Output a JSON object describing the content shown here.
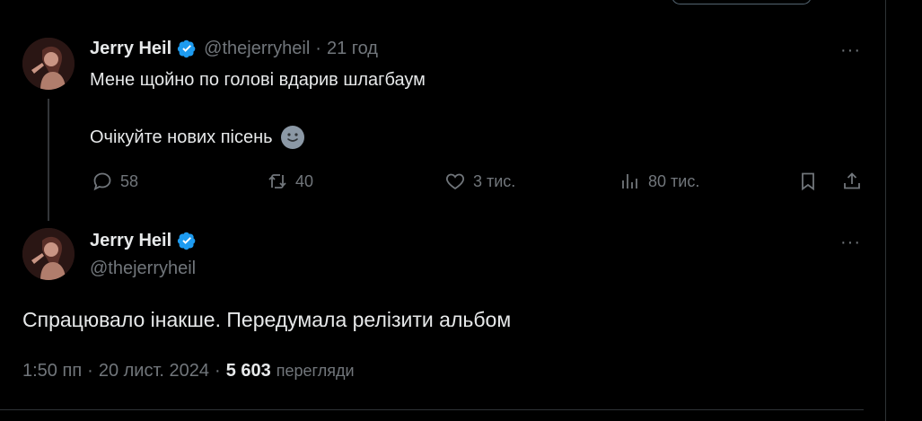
{
  "colors": {
    "background": "#000000",
    "text": "#e7e9ea",
    "muted": "#71767b",
    "verified": "#1d9bf0",
    "border": "#2f3336"
  },
  "parent_tweet": {
    "author_name": "Jerry Heil",
    "handle": "@thejerryheil",
    "separator": "·",
    "time": "21 год",
    "line1": "Мене щойно по голові вдарив шлагбаум",
    "line2": "Очікуйте нових пісень",
    "emoji_icon": "smiling-face-icon",
    "actions": {
      "replies": "58",
      "reposts": "40",
      "likes": "3 тис.",
      "views": "80 тис."
    }
  },
  "main_tweet": {
    "author_name": "Jerry Heil",
    "handle": "@thejerryheil",
    "text": "Спрацювало інакше. Передумала релізити альбом",
    "time": "1:50 пп",
    "dot1": "·",
    "date": "20 лист. 2024",
    "dot2": "·",
    "views_count": "5 603",
    "views_label": "перегляди"
  },
  "more_glyph": "···"
}
